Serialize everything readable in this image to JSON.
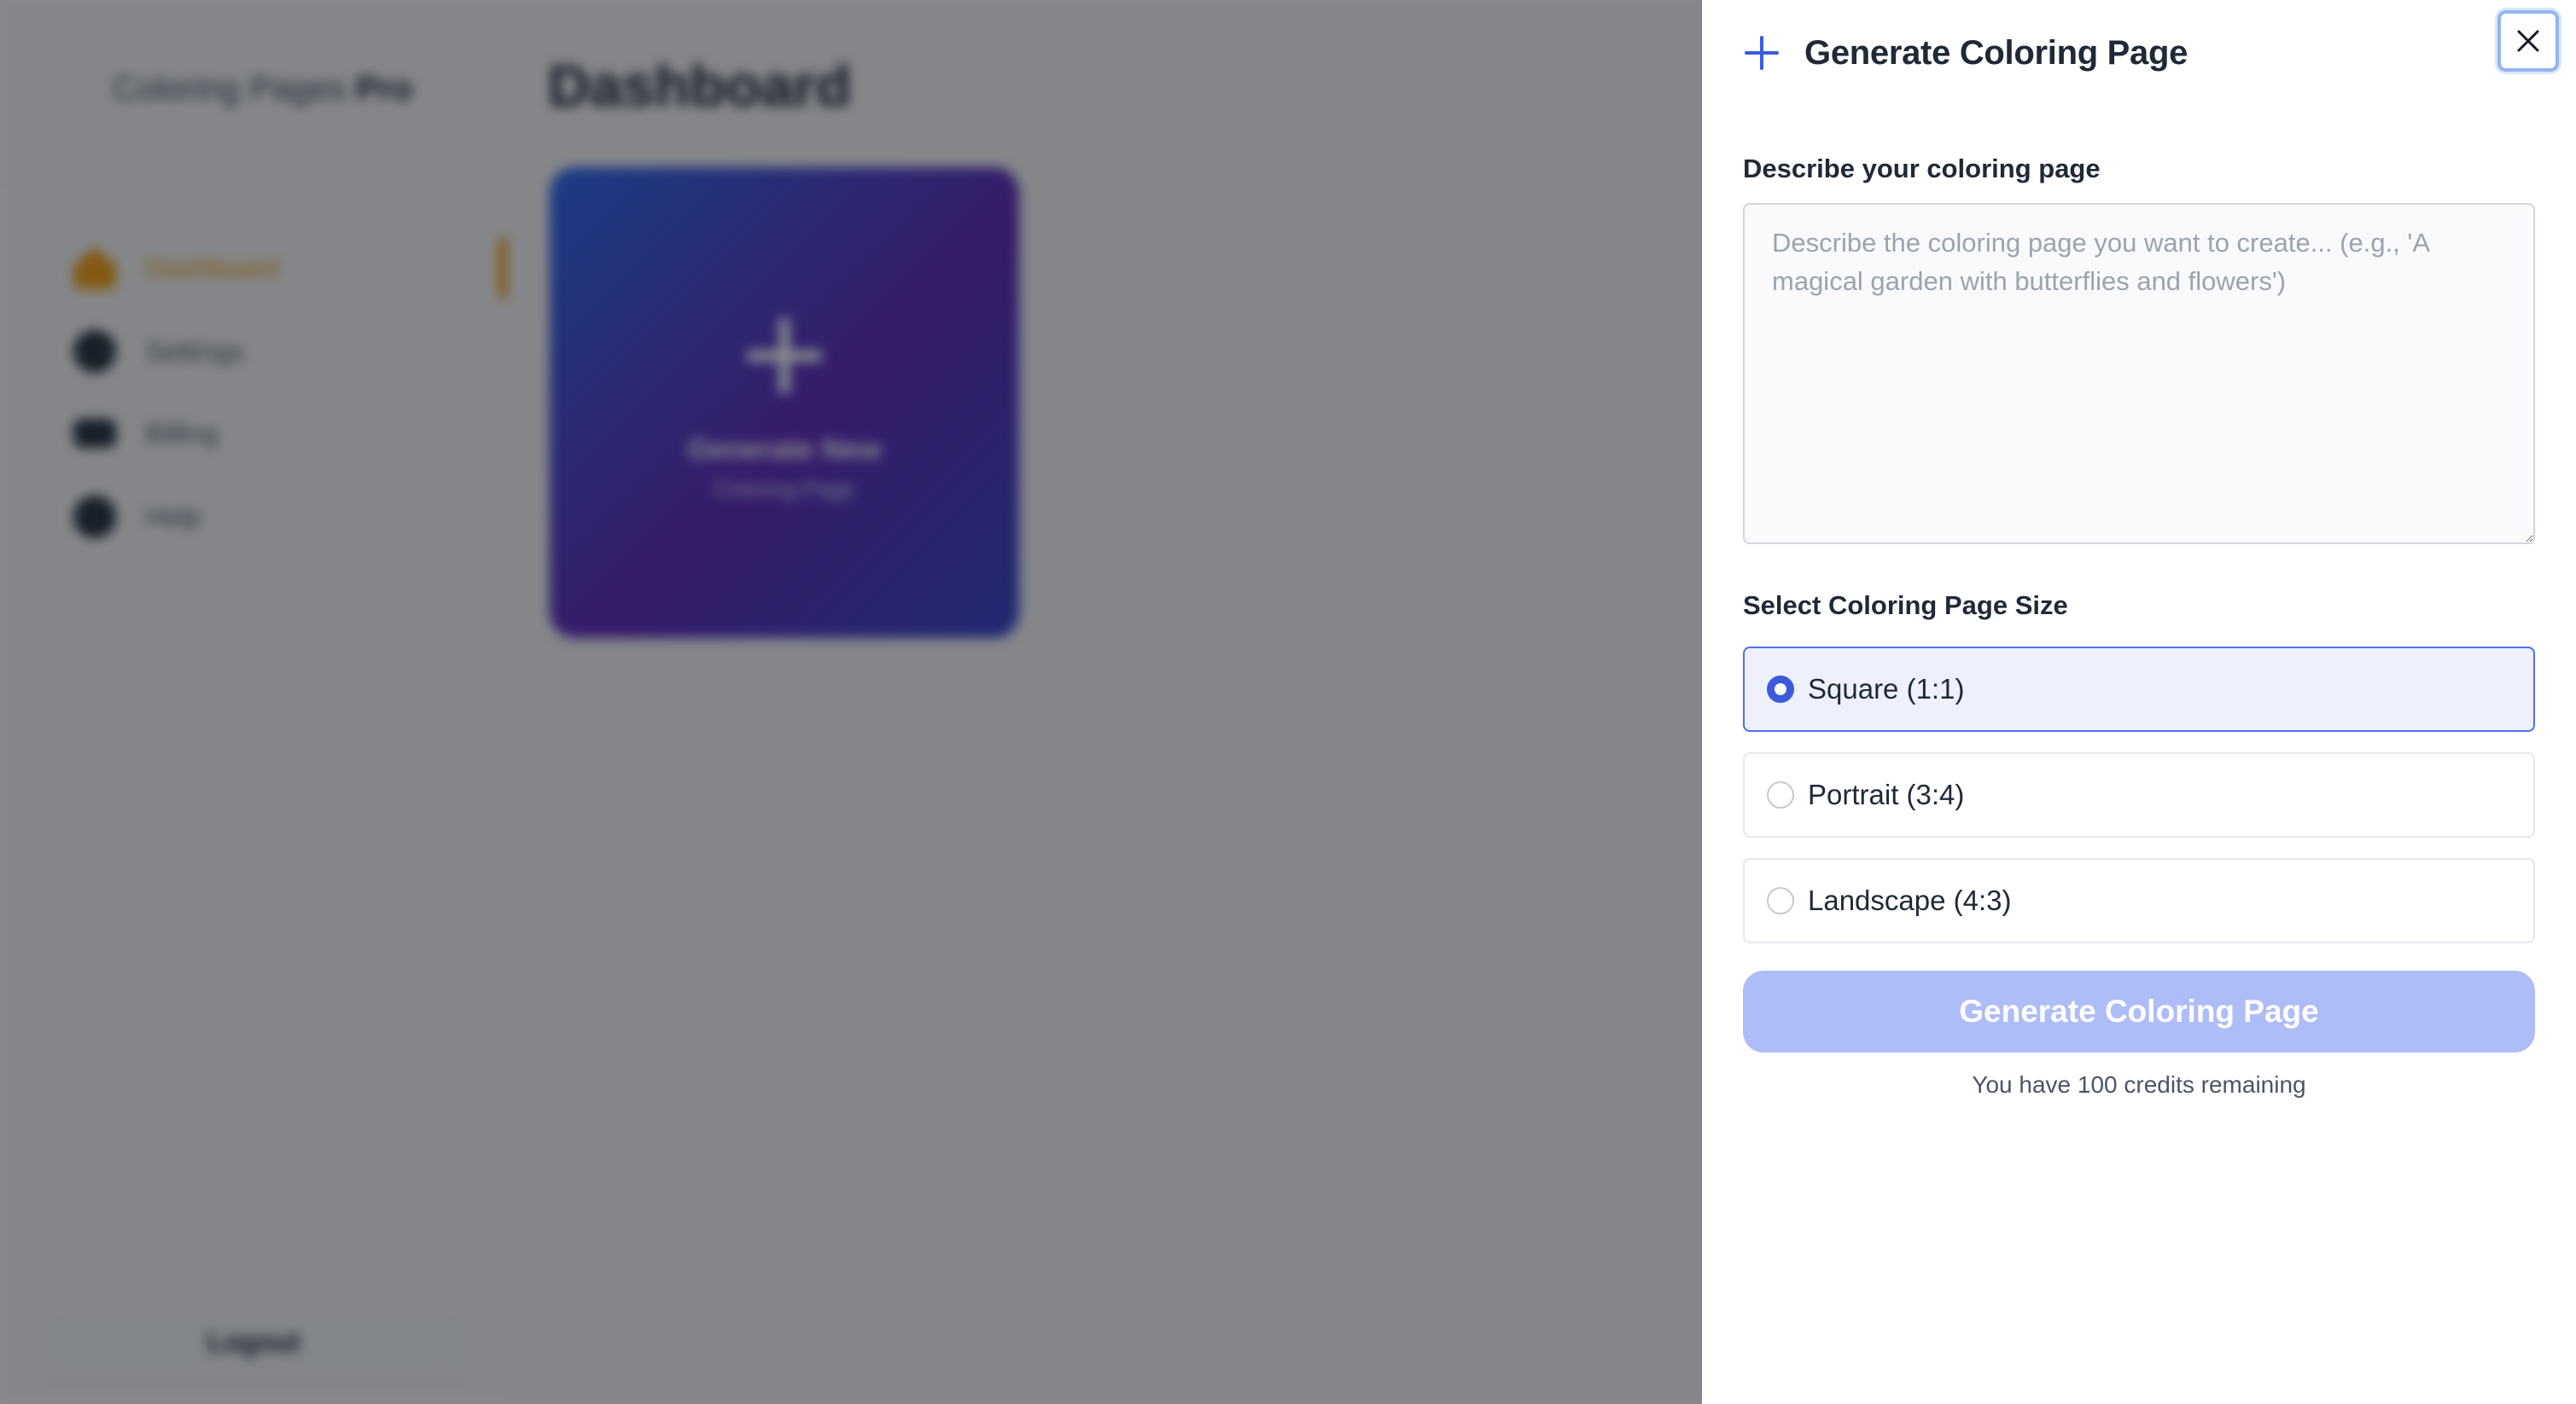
{
  "background": {
    "brand": {
      "name": "Coloring Pages",
      "suffix": "Pro"
    },
    "nav": [
      {
        "label": "Dashboard",
        "icon": "home-icon",
        "active": true
      },
      {
        "label": "Settings",
        "icon": "gear-icon"
      },
      {
        "label": "Billing",
        "icon": "card-icon"
      },
      {
        "label": "Help",
        "icon": "help-icon"
      }
    ],
    "logout_label": "Logout",
    "page_title": "Dashboard",
    "card": {
      "title": "Generate New",
      "subtitle": "Coloring Page",
      "icon": "plus-icon"
    }
  },
  "drawer": {
    "title": "Generate Coloring Page",
    "icon": "plus-icon",
    "close_icon": "close-icon",
    "description": {
      "label": "Describe your coloring page",
      "value": "",
      "placeholder": "Describe the coloring page you want to create... (e.g., 'A magical garden with butterflies and flowers')"
    },
    "size": {
      "label": "Select Coloring Page Size",
      "options": [
        {
          "label": "Square (1:1)",
          "selected": true
        },
        {
          "label": "Portrait (3:4)",
          "selected": false
        },
        {
          "label": "Landscape (4:3)",
          "selected": false
        }
      ]
    },
    "generate_label": "Generate Coloring Page",
    "credits_text": "You have 100 credits remaining"
  },
  "colors": {
    "accent": "#3b5bdb",
    "button_disabled": "#aebdf8",
    "selected_bg": "#eef1fb",
    "nav_active": "#f59e0b"
  }
}
